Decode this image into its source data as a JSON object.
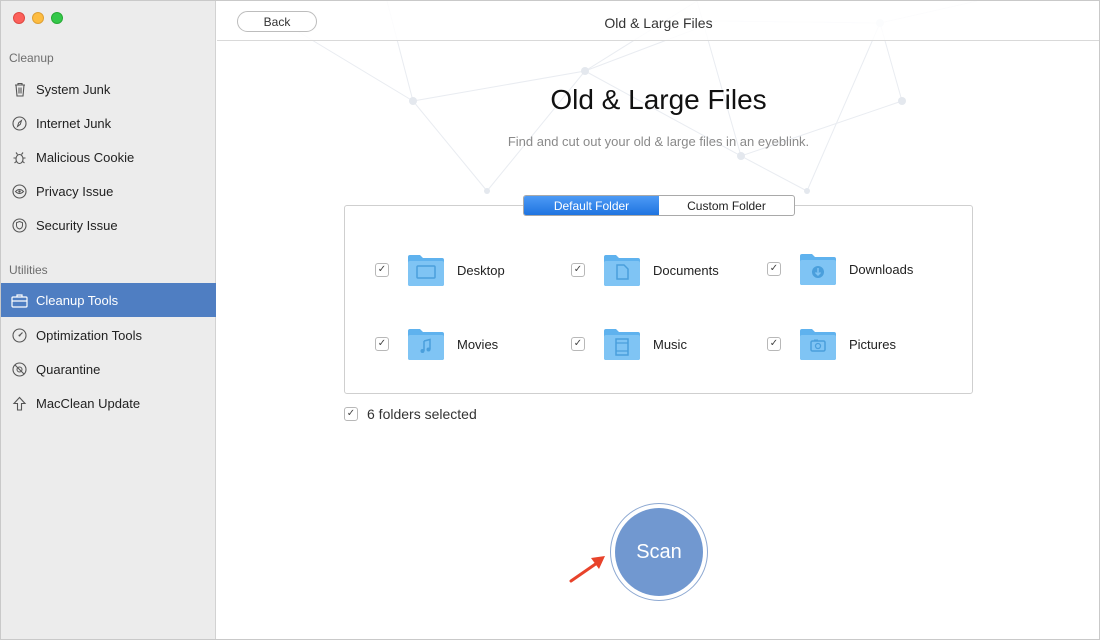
{
  "window": {
    "title": "Old & Large Files",
    "back_label": "Back"
  },
  "sidebar": {
    "sections": [
      {
        "title": "Cleanup",
        "items": [
          {
            "label": "System Junk",
            "icon": "trash-icon"
          },
          {
            "label": "Internet Junk",
            "icon": "compass-icon"
          },
          {
            "label": "Malicious Cookie",
            "icon": "bug-icon"
          },
          {
            "label": "Privacy Issue",
            "icon": "eye-icon"
          },
          {
            "label": "Security Issue",
            "icon": "shield-icon"
          }
        ]
      },
      {
        "title": "Utilities",
        "items": [
          {
            "label": "Cleanup Tools",
            "icon": "toolbox-icon",
            "active": true
          },
          {
            "label": "Optimization Tools",
            "icon": "gauge-icon"
          },
          {
            "label": "Quarantine",
            "icon": "biohazard-icon"
          },
          {
            "label": "MacClean Update",
            "icon": "arrow-up-icon"
          }
        ]
      }
    ]
  },
  "main": {
    "title": "Old & Large Files",
    "subtitle": "Find and cut out your old & large files in an eyeblink.",
    "tabs": [
      {
        "label": "Default Folder",
        "active": true
      },
      {
        "label": "Custom Folder",
        "active": false
      }
    ],
    "folders": [
      {
        "label": "Desktop",
        "checked": true,
        "icon": "desktop-folder-icon"
      },
      {
        "label": "Documents",
        "checked": true,
        "icon": "documents-folder-icon"
      },
      {
        "label": "Downloads",
        "checked": true,
        "icon": "downloads-folder-icon"
      },
      {
        "label": "Movies",
        "checked": true,
        "icon": "movies-folder-icon"
      },
      {
        "label": "Music",
        "checked": true,
        "icon": "music-folder-icon"
      },
      {
        "label": "Pictures",
        "checked": true,
        "icon": "pictures-folder-icon"
      }
    ],
    "selected_summary": "6 folders selected",
    "scan_label": "Scan"
  },
  "colors": {
    "accent": "#4f7ec2",
    "scan_button": "#7198d0",
    "folder_blue": "#6ab7ef",
    "arrow_red": "#e8432b"
  }
}
